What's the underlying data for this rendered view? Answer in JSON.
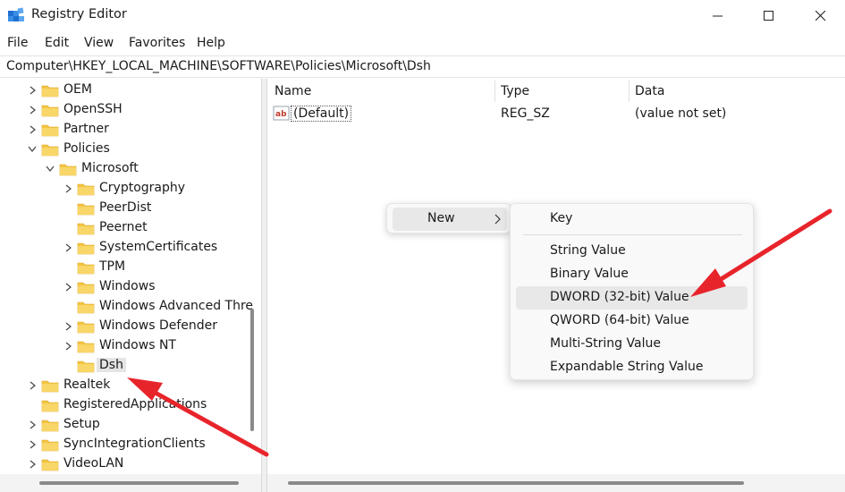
{
  "window": {
    "title": "Registry Editor",
    "icon": "registry-editor-icon"
  },
  "menu": {
    "items": [
      "File",
      "Edit",
      "View",
      "Favorites",
      "Help"
    ]
  },
  "address": {
    "path": "Computer\\HKEY_LOCAL_MACHINE\\SOFTWARE\\Policies\\Microsoft\\Dsh"
  },
  "tree": {
    "items": [
      {
        "label": "OEM",
        "expander": "collapsed"
      },
      {
        "label": "OpenSSH",
        "expander": "collapsed"
      },
      {
        "label": "Partner",
        "expander": "collapsed"
      },
      {
        "label": "Policies",
        "expander": "expanded"
      },
      {
        "label": "Microsoft",
        "expander": "expanded"
      },
      {
        "label": "Cryptography",
        "expander": "collapsed"
      },
      {
        "label": "PeerDist",
        "expander": "none"
      },
      {
        "label": "Peernet",
        "expander": "none"
      },
      {
        "label": "SystemCertificates",
        "expander": "collapsed"
      },
      {
        "label": "TPM",
        "expander": "none"
      },
      {
        "label": "Windows",
        "expander": "collapsed"
      },
      {
        "label": "Windows Advanced Thre",
        "expander": "none"
      },
      {
        "label": "Windows Defender",
        "expander": "collapsed"
      },
      {
        "label": "Windows NT",
        "expander": "collapsed"
      },
      {
        "label": "Dsh",
        "expander": "none",
        "selected": true
      },
      {
        "label": "Realtek",
        "expander": "collapsed"
      },
      {
        "label": "RegisteredApplications",
        "expander": "none"
      },
      {
        "label": "Setup",
        "expander": "collapsed"
      },
      {
        "label": "SyncIntegrationClients",
        "expander": "collapsed"
      },
      {
        "label": "VideoLAN",
        "expander": "collapsed"
      }
    ]
  },
  "values": {
    "columns": [
      "Name",
      "Type",
      "Data"
    ],
    "rows": [
      {
        "name": "(Default)",
        "type": "REG_SZ",
        "data": "(value not set)",
        "icon": "string-value-icon"
      }
    ]
  },
  "context_menu": {
    "new_label": "New",
    "submenu": {
      "key_label": "Key",
      "items": [
        {
          "label": "String Value",
          "hover": false
        },
        {
          "label": "Binary Value",
          "hover": false
        },
        {
          "label": "DWORD (32-bit) Value",
          "hover": true
        },
        {
          "label": "QWORD (64-bit) Value",
          "hover": false
        },
        {
          "label": "Multi-String Value",
          "hover": false
        },
        {
          "label": "Expandable String Value",
          "hover": false
        }
      ]
    }
  },
  "colors": {
    "folder": "#f4c542",
    "annotation_arrow": "#e8242b",
    "selection": "#e5e5e5"
  }
}
